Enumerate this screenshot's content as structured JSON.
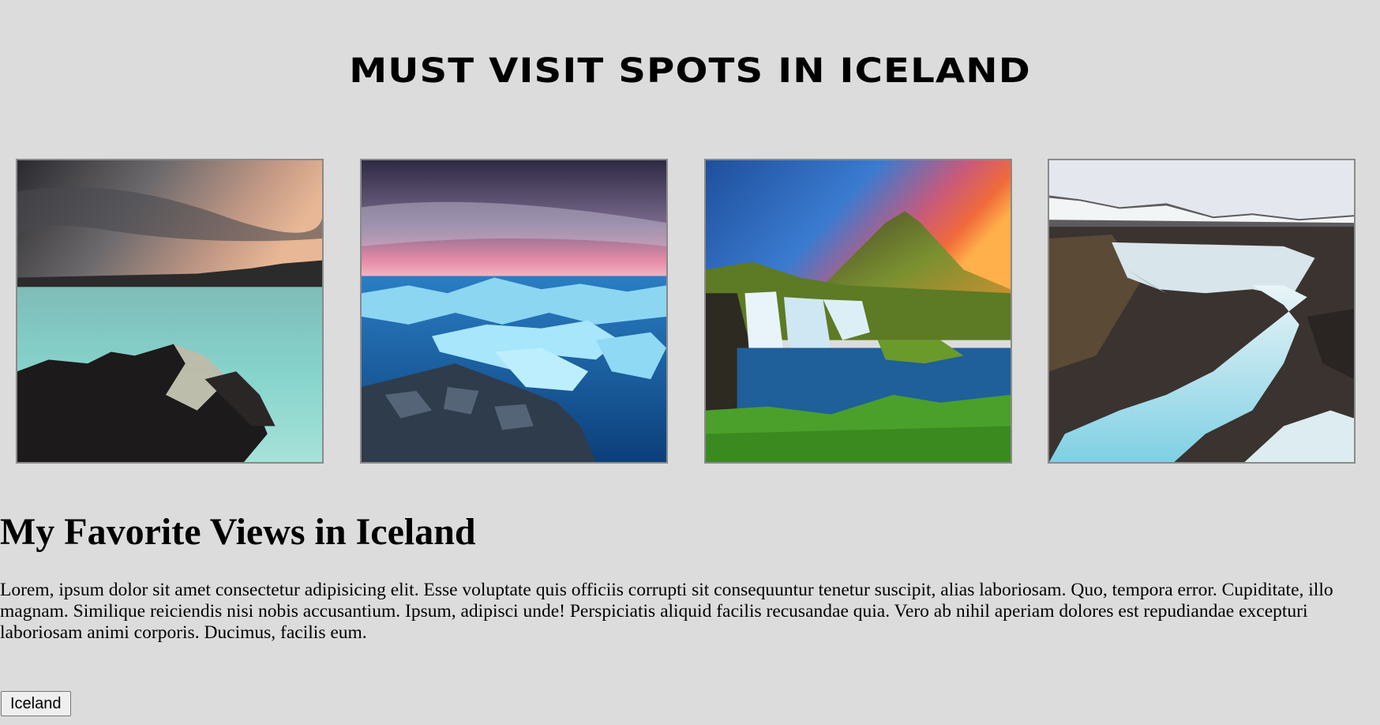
{
  "header": {
    "title": "Must Visit Spots In Iceland"
  },
  "gallery": {
    "photos": [
      {
        "icon": "blue-lagoon-photo"
      },
      {
        "icon": "glacier-lagoon-photo"
      },
      {
        "icon": "kirkjufell-waterfall-photo"
      },
      {
        "icon": "river-waterfall-photo"
      }
    ]
  },
  "main": {
    "heading": "My Favorite Views in Iceland",
    "paragraph": "Lorem, ipsum dolor sit amet consectetur adipisicing elit. Esse voluptate quis officiis corrupti sit consequuntur tenetur suscipit, alias laboriosam. Quo, tempora error. Cupiditate, illo magnam. Similique reiciendis nisi nobis accusantium. Ipsum, adipisci unde! Perspiciatis aliquid facilis recusandae quia. Vero ab nihil aperiam dolores est repudiandae excepturi laboriosam animi corporis. Ducimus, facilis eum.",
    "button_label": "Iceland"
  },
  "colors": {
    "background": "#dcdcdc",
    "photo_border": "#8a8a8a"
  }
}
